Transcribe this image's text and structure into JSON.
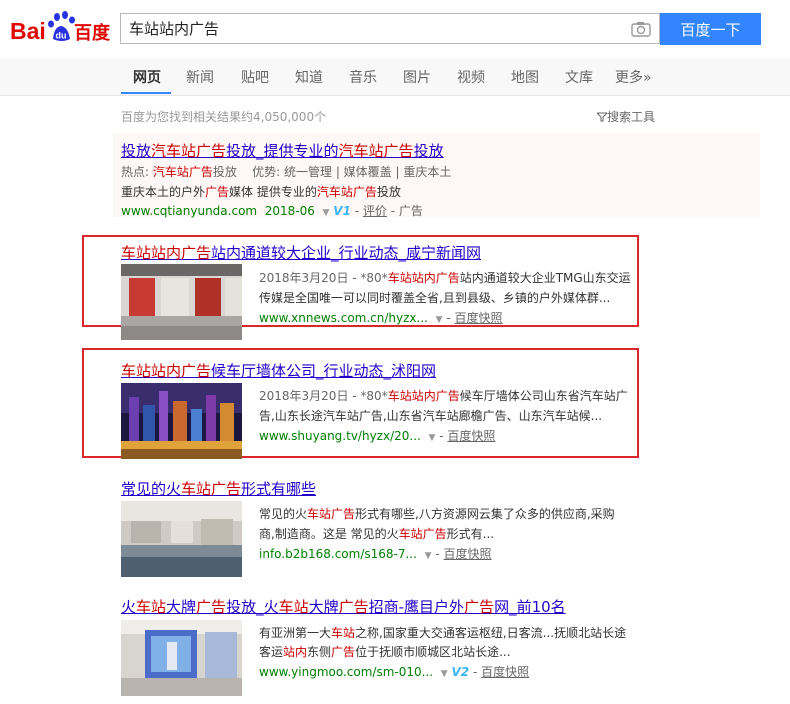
{
  "search": {
    "query": "车站站内广告",
    "button_label": "百度一下"
  },
  "nav": {
    "tabs": [
      "网页",
      "新闻",
      "贴吧",
      "知道",
      "音乐",
      "图片",
      "视频",
      "地图",
      "文库",
      "更多»"
    ]
  },
  "results_info": {
    "count_text": "百度为您找到相关结果约4,050,000个",
    "tools_label": "搜索工具"
  },
  "ad": {
    "title_parts": [
      "投放",
      "汽车站广告",
      "投放_提供专业的",
      "汽车站广告",
      "投放"
    ],
    "line1_parts": [
      "热点: ",
      "汽车站广告",
      "投放",
      "优势: 统一管理 | 媒体覆盖 | 重庆本土"
    ],
    "line2_parts": [
      "重庆本土的户外",
      "广告",
      "媒体  提供专业的",
      "汽车站广告",
      "投放"
    ],
    "url": "www.cqtianyunda.com",
    "date": "2018-06",
    "badge": "V1",
    "rating": "评价",
    "tag": "- 广告"
  },
  "results": [
    {
      "title_parts": [
        "车站站内广告",
        "站内通道较大企业_行业动态_咸宁新闻网"
      ],
      "line1_parts": [
        "2018年3月20日 - *80*",
        "车站站内广告",
        "站内通道较大企业TMG山东交运"
      ],
      "line2": "传媒是全国唯一可以同时覆盖全省,且到县级、乡镇的户外媒体群...",
      "url": "www.xnnews.com.cn/hyzx...",
      "snapshot": "百度快照"
    },
    {
      "title_parts": [
        "车站站内广告",
        "候车厅墙体公司_行业动态_沭阳网"
      ],
      "line1_parts": [
        "2018年3月20日 - *80*",
        "车站站内广告",
        "候车厅墙体公司山东省汽车站广"
      ],
      "line2": "告,山东长途汽车站广告,山东省汽车站廊檐广告、山东汽车站候...",
      "url": "www.shuyang.tv/hyzx/20...",
      "snapshot": "百度快照"
    },
    {
      "title_parts": [
        "常见的火",
        "车站广告",
        "形式有哪些"
      ],
      "line1_parts": [
        "常见的火",
        "车站广告",
        "形式有哪些,八方资源网云集了众多的供应商,采购"
      ],
      "line2_parts": [
        "商,制造商。这是 常见的火",
        "车站广告",
        "形式有..."
      ],
      "url": "info.b2b168.com/s168-7...",
      "snapshot": "百度快照"
    },
    {
      "title_parts": [
        "火",
        "车站",
        "大牌",
        "广告",
        "投放_火",
        "车站",
        "大牌",
        "广告",
        "招商-鹰目户外",
        "广告",
        "网_前10名"
      ],
      "line1_parts": [
        "有亚洲第一大",
        "车站",
        "之称,国家重大交通客运枢纽,日客流...抚顺北站长途"
      ],
      "line2_parts": [
        "客运",
        "站内",
        "东侧",
        "广告",
        "位于抚顺市顺城区北站长途..."
      ],
      "url": "www.yingmoo.com/sm-010...",
      "badge": "V2",
      "snapshot": "百度快照"
    }
  ],
  "colors": {
    "brand_blue": "#3385ff",
    "link": "#2200cc",
    "highlight": "#cc0000",
    "url_green": "#008000",
    "annotation_red": "#d9272a"
  }
}
